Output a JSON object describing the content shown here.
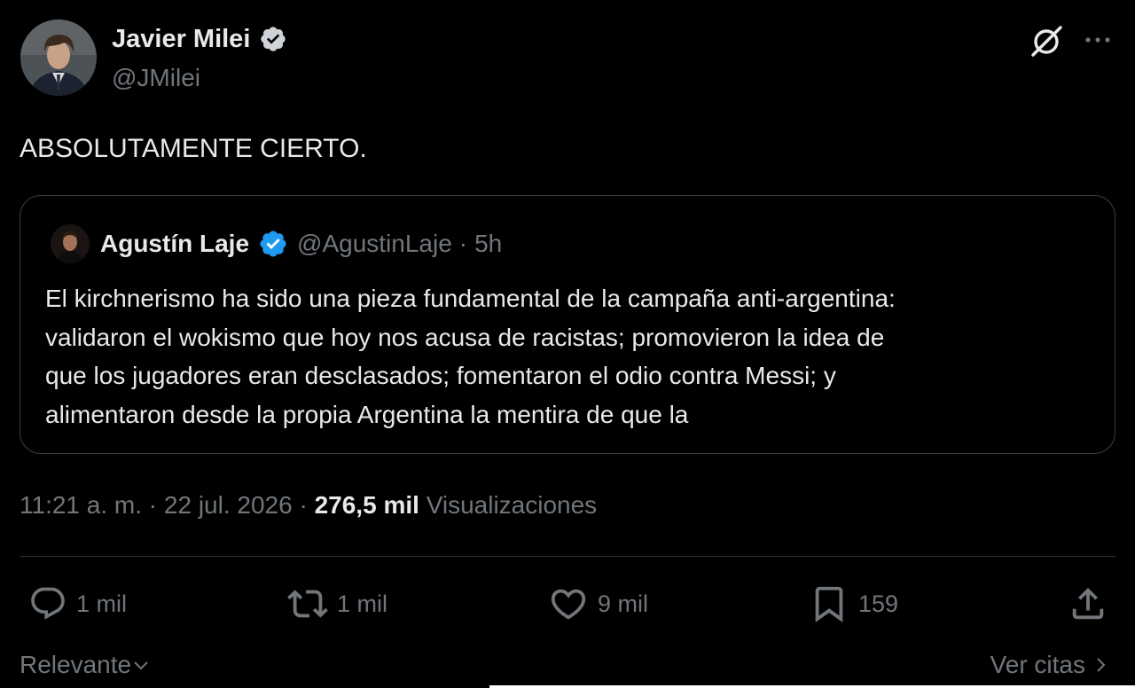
{
  "author": {
    "name": "Javier Milei",
    "handle": "@JMilei",
    "verified": true
  },
  "tweet": {
    "text": "ABSOLUTAMENTE CIERTO."
  },
  "quoted": {
    "name": "Agustín Laje",
    "handle": "@AgustinLaje",
    "separator": "·",
    "time": "5h",
    "verified": true,
    "text_lines": [
      "El kirchnerismo ha sido una pieza fundamental de la campaña anti-argentina:",
      "validaron el wokismo que hoy nos acusa de racistas; promovieron la idea de",
      "que los jugadores eran desclasados; fomentaron el odio contra Messi; y",
      "alimentaron desde la propia Argentina la mentira de que la"
    ]
  },
  "meta": {
    "time": "11:21 a. m.",
    "sep1": "·",
    "date": "22 jul. 2026",
    "sep2": "·",
    "views_count": "276,5 mil",
    "views_label": "Visualizaciones"
  },
  "actions": {
    "replies": "1 mil",
    "reposts": "1 mil",
    "likes": "9 mil",
    "bookmarks": "159"
  },
  "footer": {
    "sort_label": "Relevante",
    "quotes_label": "Ver citas"
  },
  "colors": {
    "background": "#000000",
    "text": "#e7e9ea",
    "muted": "#71767b",
    "verified": "#1d9bf0",
    "border": "#3a3f44"
  },
  "icons": [
    "grok-icon",
    "more-icon",
    "verified-icon",
    "reply-icon",
    "repost-icon",
    "like-icon",
    "bookmark-icon",
    "share-icon",
    "chevron-down-icon",
    "chevron-right-icon"
  ]
}
